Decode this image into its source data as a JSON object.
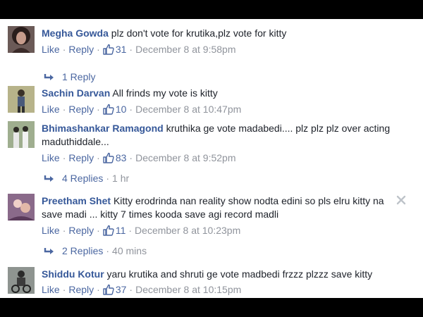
{
  "actions": {
    "like": "Like",
    "reply": "Reply",
    "dot": "·"
  },
  "colors": {
    "link": "#4b67a1",
    "author": "#365899",
    "meta": "#90949c"
  },
  "comments": [
    {
      "author": "Megha Gowda",
      "text": "plz don't vote for krutika,plz vote for kitty",
      "likes": "31",
      "date": "December 8 at 9:58pm",
      "replies": "1 Reply",
      "replies_time": ""
    },
    {
      "author": "Sachin Darvan",
      "text": "All frinds my vote is kitty",
      "likes": "10",
      "date": "December 8 at 10:47pm"
    },
    {
      "author": "Bhimashankar Ramagond",
      "text": "kruthika ge vote madabedi.... plz plz plz over acting maduthiddale...",
      "likes": "83",
      "date": "December 8 at 9:52pm",
      "replies": "4 Replies",
      "replies_time": "1 hr"
    },
    {
      "author": "Preetham Shet",
      "text": "Kitty erodrinda nan reality show nodta edini so pls elru kitty na save madi ... kitty 7 times kooda save agi record madli",
      "likes": "11",
      "date": "December 8 at 10:23pm",
      "replies": "2 Replies",
      "replies_time": "40 mins"
    },
    {
      "author": "Shiddu Kotur",
      "text": "yaru krutika and shruti ge vote madbedi frzzz plzzz save kitty",
      "likes": "37",
      "date": "December 8 at 10:15pm"
    }
  ]
}
